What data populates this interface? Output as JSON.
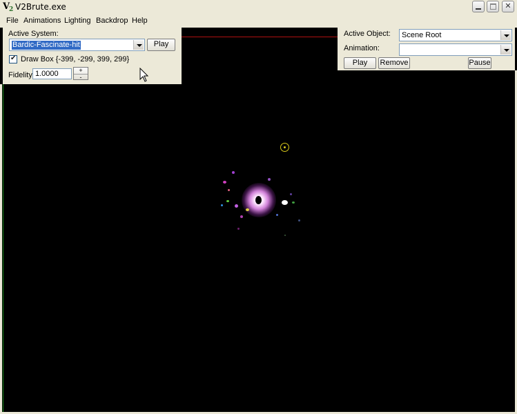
{
  "window": {
    "title": "V2Brute.exe",
    "icon": "v2-app-icon",
    "controls": [
      "minimize-icon",
      "maximize-icon",
      "close-icon"
    ]
  },
  "menu": {
    "file": "File",
    "animations": "Animations",
    "lighting": "Lighting",
    "backdrop": "Backdrop",
    "help": "Help"
  },
  "left_panel": {
    "active_system_label": "Active System:",
    "active_system_value": "Bardic-Fascinate-hit",
    "play_label": "Play",
    "draw_box_checked": true,
    "draw_box_label": "Draw Box {-399, -299, 399, 299}",
    "fidelity_label": "Fidelity",
    "fidelity_value": "1.0000",
    "increment_label": "+",
    "decrement_label": "-"
  },
  "right_panel": {
    "active_object_label": "Active Object:",
    "active_object_value": "Scene Root",
    "animation_label": "Animation:",
    "animation_value": "",
    "play_label": "Play",
    "remove_label": "Remove",
    "pause_label": "Pause"
  },
  "viewport": {
    "background": "#000000",
    "bound_top_color": "#b01010",
    "bound_left_color": "#1a8a1a",
    "particle_core_color": "#ffffff",
    "particle_glow_color": "#d080d8",
    "marker_color": "#d8c81a"
  }
}
